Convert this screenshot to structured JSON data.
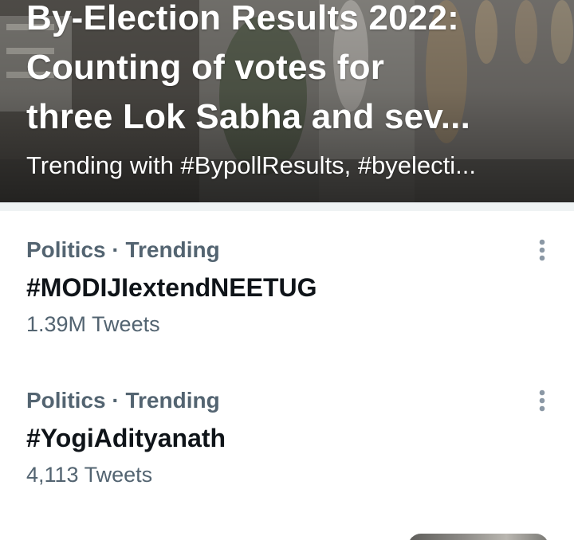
{
  "hero": {
    "title_lines": [
      "By-Election Results 2022:",
      "Counting of votes for",
      "three Lok Sabha and sev..."
    ],
    "subtitle": "Trending with #BypollResults, #byelecti..."
  },
  "trends": [
    {
      "meta": "Politics · Trending",
      "name": "#MODIJIextendNEETUG",
      "count": "1.39M Tweets",
      "more_icon": "more-vertical-icon"
    },
    {
      "meta": "Politics · Trending",
      "name": "#YogiAdityanath",
      "count": "4,113 Tweets",
      "more_icon": "more-vertical-icon"
    }
  ],
  "colors": {
    "primary_text": "#0f1419",
    "secondary_text": "#536471",
    "divider": "#eff3f4",
    "background": "#ffffff"
  }
}
